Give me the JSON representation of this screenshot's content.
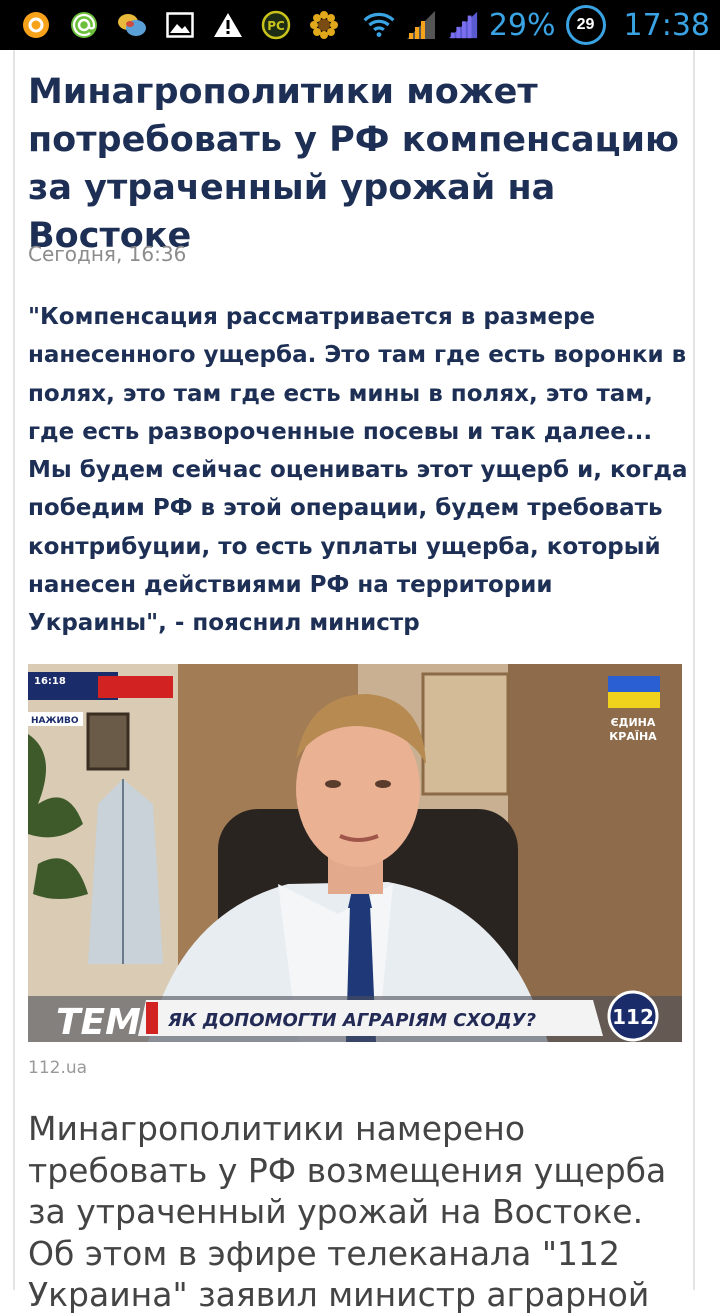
{
  "status_bar": {
    "battery_percent": "29%",
    "battery_badge": "29",
    "time": "17:38",
    "icons": [
      "orange-circle-icon",
      "email-at-icon",
      "chat-bubbles-icon",
      "gallery-image-icon",
      "warning-icon",
      "rc-app-icon",
      "gear-flower-icon",
      "wifi-icon",
      "signal-bars-icon",
      "signal-bars-2-icon"
    ]
  },
  "article": {
    "title": "Минагрополитики может потребовать у РФ компенсацию за утраченный урожай на Востоке",
    "date": "Сегодня, 16:36",
    "lead": "\"Компенсация рассматривается в размере нанесенного ущерба. Это там где есть воронки в полях, это там где есть мины в полях, это там, где есть развороченные посевы и так далее... Мы будем сейчас оценивать этот ущерб и, когда победим РФ в этой операции, будем требовать контрибуции, то есть уплаты ущерба, который нанесен действиями РФ на территории Украины\", - пояснил министр",
    "image": {
      "tv_ticker_label": "ТЕМА",
      "tv_ticker_text": "ЯК ДОПОМОГТИ АГРАРІЯМ СХОДУ?",
      "channel_badge": "112",
      "corner_time": "16:18",
      "corner_live": "НАЖИВО",
      "watermark_line1": "ЄДИНА",
      "watermark_line2": "КРАЇНА"
    },
    "caption": "112.ua",
    "body": "Минагрополитики намерено требовать у РФ возмещения ущерба за утраченный урожай на Востоке. Об этом в эфире телеканала \"112 Украина\" заявил министр аграрной"
  },
  "colors": {
    "title": "#1d2f54",
    "status_accent": "#3aa3e3",
    "date": "#8c8c8c"
  }
}
